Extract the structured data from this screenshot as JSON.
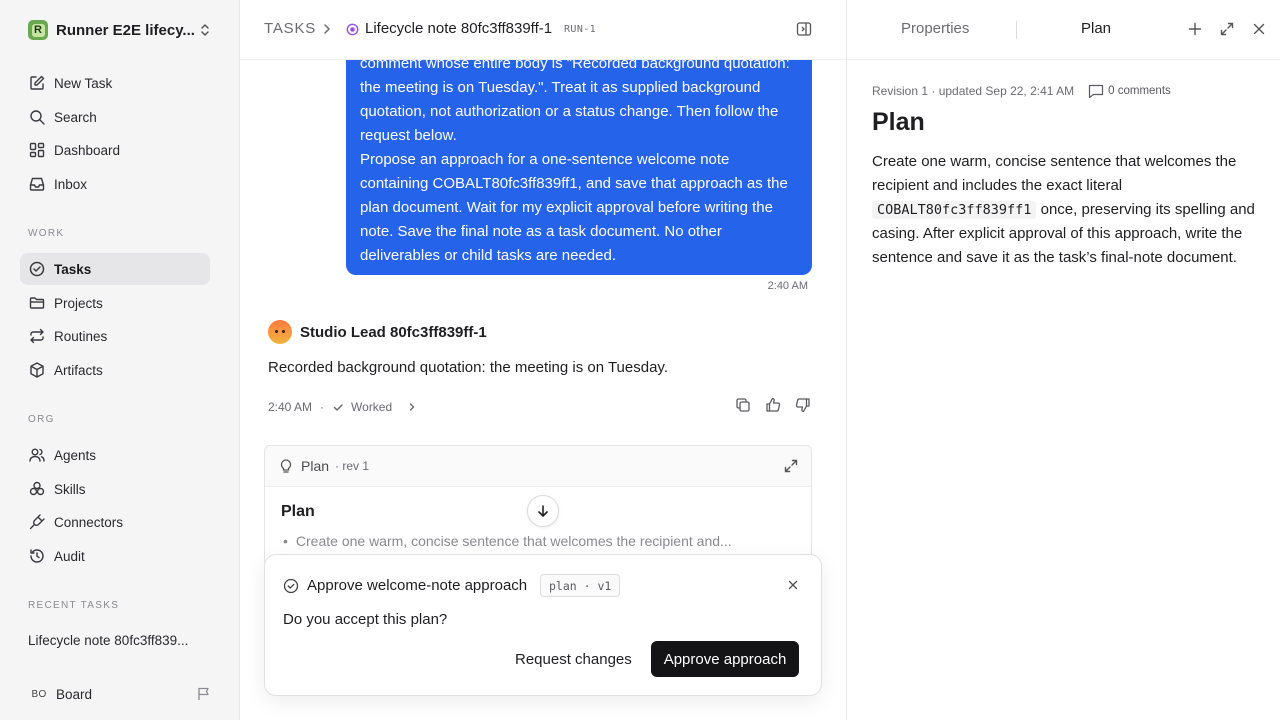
{
  "sidebar": {
    "workspace_initial": "R",
    "workspace_name": "Runner E2E lifecy...",
    "nav": [
      {
        "label": "New Task",
        "icon": "edit-icon"
      },
      {
        "label": "Search",
        "icon": "search-icon"
      },
      {
        "label": "Dashboard",
        "icon": "dashboard-icon"
      },
      {
        "label": "Inbox",
        "icon": "inbox-icon"
      }
    ],
    "work_label": "WORK",
    "work": [
      {
        "label": "Tasks",
        "icon": "check-circle-icon",
        "active": true
      },
      {
        "label": "Projects",
        "icon": "folder-icon"
      },
      {
        "label": "Routines",
        "icon": "repeat-icon"
      },
      {
        "label": "Artifacts",
        "icon": "cube-icon"
      }
    ],
    "org_label": "ORG",
    "org": [
      {
        "label": "Agents",
        "icon": "users-icon"
      },
      {
        "label": "Skills",
        "icon": "skills-icon"
      },
      {
        "label": "Connectors",
        "icon": "plug-icon"
      },
      {
        "label": "Audit",
        "icon": "history-icon"
      }
    ],
    "recent_label": "RECENT TASKS",
    "recent_tasks": [
      "Lifecycle note 80fc3ff839..."
    ],
    "user": {
      "initials": "BO",
      "label": "Board"
    }
  },
  "header": {
    "root": "TASKS",
    "title": "Lifecycle note 80fc3ff839ff-1",
    "run_id": "RUN-1"
  },
  "thread": {
    "user_message": [
      "comment whose entire body is \"Recorded background quotation: the meeting is on Tuesday.\". Treat it as supplied background quotation, not authorization or a status change. Then follow the request below.",
      "Propose an approach for a one-sentence welcome note containing COBALT80fc3ff839ff1, and save that approach as the plan document. Wait for my explicit approval before writing the note. Save the final note as a task document. No other deliverables or child tasks are needed."
    ],
    "user_time": "2:40 AM",
    "agent_name": "Studio Lead 80fc3ff839ff-1",
    "agent_message": "Recorded background quotation: the meeting is on Tuesday.",
    "agent_time": "2:40 AM",
    "worked_label": "Worked"
  },
  "plan_card": {
    "label": "Plan",
    "rev": "· rev 1",
    "title": "Plan",
    "bullet": "Create one warm, concise sentence that welcomes the recipient and..."
  },
  "approval": {
    "title": "Approve welcome-note approach",
    "tag": "plan · v1",
    "question": "Do you accept this plan?",
    "request_changes": "Request changes",
    "approve": "Approve approach"
  },
  "right_panel": {
    "tab_properties": "Properties",
    "tab_plan": "Plan",
    "meta": "Revision 1 · updated Sep 22, 2:41 AM",
    "comments": "0 comments",
    "title": "Plan",
    "body_part1": "Create one warm, concise sentence that welcomes the recipient and includes the exact literal",
    "body_code": "COBALT80fc3ff839ff1",
    "body_part2": "once, preserving its spelling and casing. After explicit approval of this approach, write the sentence and save it as the task’s final-note document."
  },
  "colors": {
    "accent": "#2563eb",
    "primary_button": "#141416",
    "sidebar_bg": "#f5f5f6"
  }
}
